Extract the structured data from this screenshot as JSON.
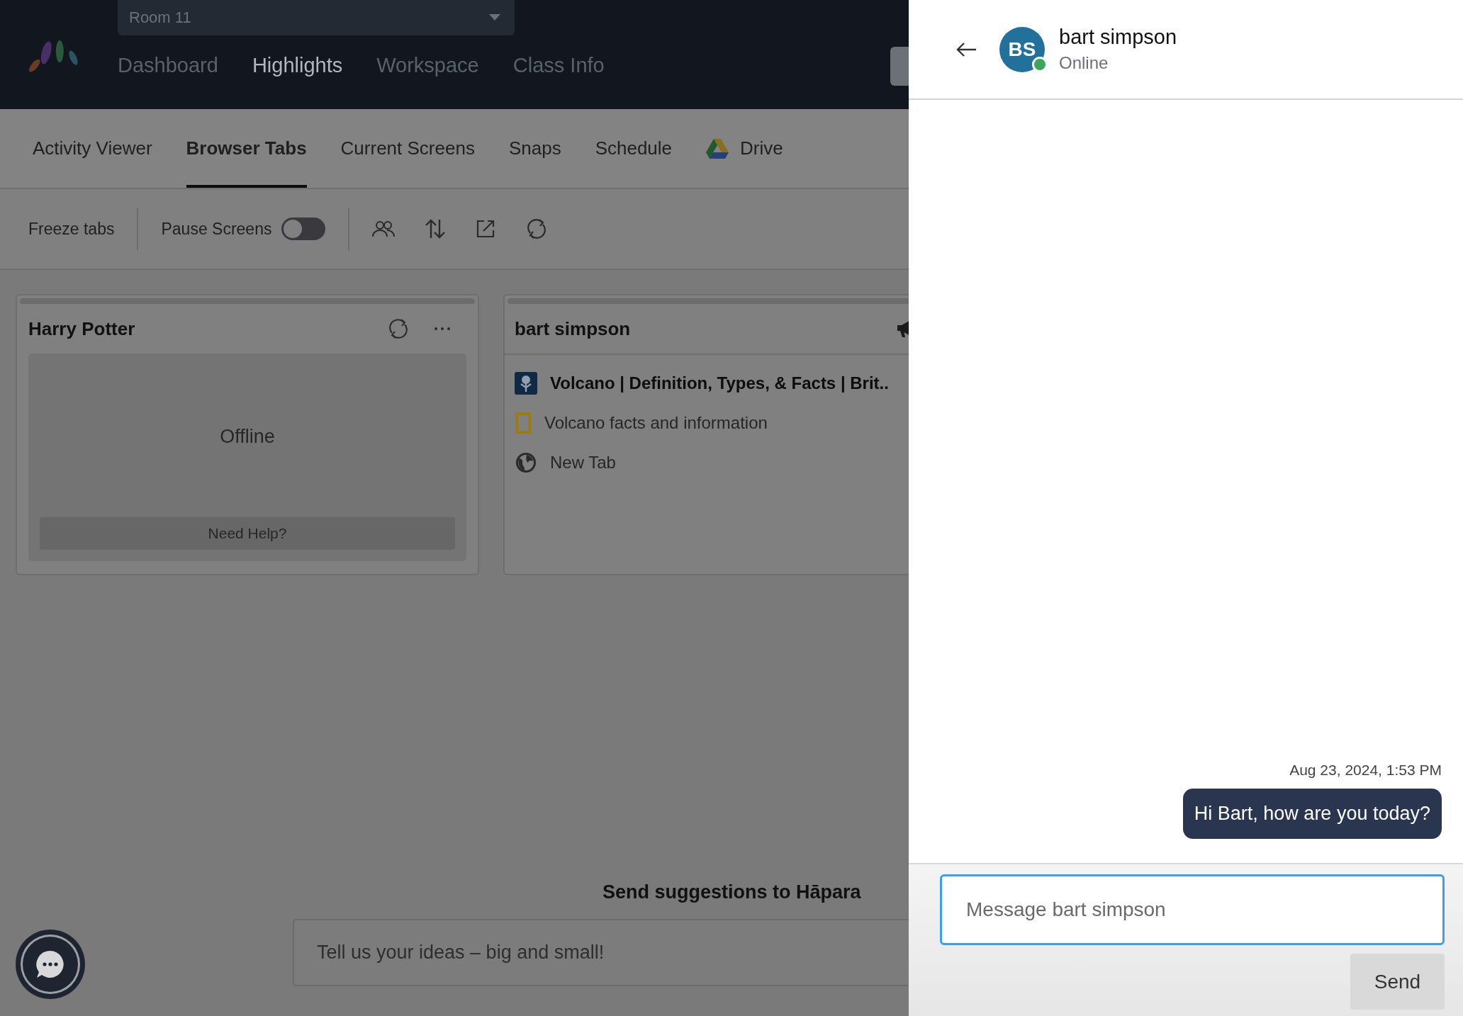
{
  "header": {
    "room_select": {
      "value": "Room 11"
    },
    "nav": [
      {
        "label": "Dashboard",
        "selected": false
      },
      {
        "label": "Highlights",
        "selected": true
      },
      {
        "label": "Workspace",
        "selected": false
      },
      {
        "label": "Class Info",
        "selected": false
      }
    ]
  },
  "tabs": [
    {
      "label": "Activity Viewer",
      "selected": false
    },
    {
      "label": "Browser Tabs",
      "selected": true
    },
    {
      "label": "Current Screens",
      "selected": false
    },
    {
      "label": "Snaps",
      "selected": false
    },
    {
      "label": "Schedule",
      "selected": false
    },
    {
      "label": "Drive",
      "selected": false,
      "kind": "drive"
    }
  ],
  "toolbar": {
    "freeze_label": "Freeze tabs",
    "pause_label": "Pause Screens",
    "pause_on": false
  },
  "cards": [
    {
      "kind": "offline",
      "name": "Harry Potter",
      "status": "Offline",
      "help_button": "Need Help?"
    },
    {
      "kind": "tabs",
      "name": "bart simpson",
      "tabs": [
        {
          "kind": "britannica",
          "title": "Volcano | Definition, Types, & Facts | Brit..",
          "active": true
        },
        {
          "kind": "natgeo",
          "title": "Volcano facts and information",
          "active": false
        },
        {
          "kind": "globe",
          "title": "New Tab",
          "active": false
        }
      ]
    }
  ],
  "feedback": {
    "title": "Send suggestions to Hāpara",
    "placeholder": "Tell us your ideas – big and small!"
  },
  "chat": {
    "initials": "BS",
    "name": "bart simpson",
    "status": "Online",
    "online": true,
    "messages": [
      {
        "time": "Aug 23, 2024, 1:53 PM",
        "text": "Hi Bart, how are you today?"
      }
    ],
    "input": {
      "placeholder": "Message bart simpson"
    },
    "send_button": "Send"
  }
}
